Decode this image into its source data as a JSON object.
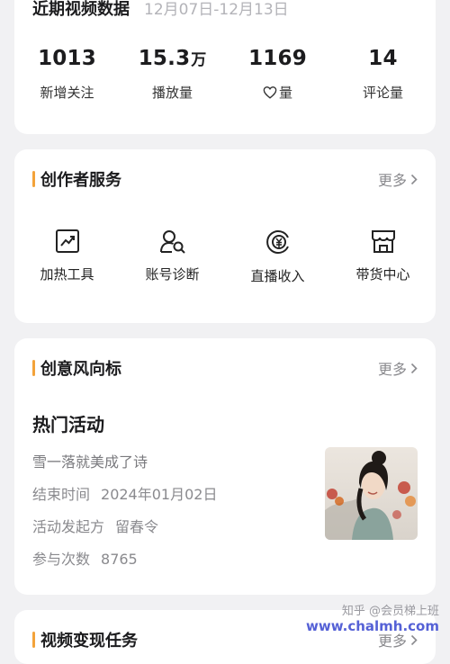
{
  "stats": {
    "title": "近期视频数据",
    "date_range": "12月07日-12月13日",
    "items": [
      {
        "value": "1013",
        "unit": "",
        "label": "新增关注"
      },
      {
        "value": "15.3",
        "unit": "万",
        "label": "播放量"
      },
      {
        "value": "1169",
        "unit": "",
        "label": "量",
        "icon": "heart-icon"
      },
      {
        "value": "14",
        "unit": "",
        "label": "评论量"
      }
    ]
  },
  "service": {
    "title": "创作者服务",
    "more": "更多",
    "items": [
      {
        "label": "加热工具",
        "icon": "trend-chart-icon"
      },
      {
        "label": "账号诊断",
        "icon": "user-search-icon"
      },
      {
        "label": "直播收入",
        "icon": "live-income-icon"
      },
      {
        "label": "带货中心",
        "icon": "store-icon"
      }
    ]
  },
  "trend": {
    "title": "创意风向标",
    "more": "更多",
    "activity": {
      "heading": "热门活动",
      "name": "雪一落就美成了诗",
      "end_label": "结束时间",
      "end_value": "2024年01月02日",
      "host_label": "活动发起方",
      "host_value": "留春令",
      "count_label": "参与次数",
      "count_value": "8765"
    }
  },
  "monetize": {
    "title": "视频变现任务",
    "more": "更多"
  },
  "watermark": {
    "line1": "知乎 @会员梯上班",
    "site": "www.chalmh.com"
  },
  "colors": {
    "accent": "#f3a33a",
    "background": "#f1f1f3",
    "card": "#ffffff",
    "muted": "#8a8a8e"
  }
}
